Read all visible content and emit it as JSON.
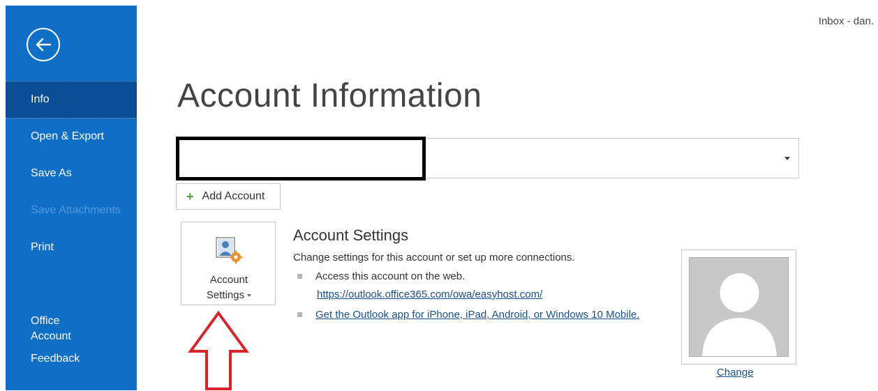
{
  "window": {
    "title": "Inbox - dan."
  },
  "sidebar": {
    "items": [
      {
        "label": "Info"
      },
      {
        "label": "Open & Export"
      },
      {
        "label": "Save As"
      },
      {
        "label": "Save Attachments"
      },
      {
        "label": "Print"
      },
      {
        "label": "Office\nAccount"
      },
      {
        "label": "Feedback"
      }
    ]
  },
  "main": {
    "title": "Account Information",
    "add_account_label": "Add Account",
    "account_settings": {
      "tile_line1": "Account",
      "tile_line2": "Settings",
      "heading": "Account Settings",
      "description": "Change settings for this account or set up more connections.",
      "web_access_text": "Access this account on the web.",
      "web_link": "https://outlook.office365.com/owa/easyhost.com/",
      "app_link": "Get the Outlook app for iPhone, iPad, Android, or Windows 10 Mobile."
    },
    "photo": {
      "change_label": "Change"
    }
  },
  "colors": {
    "sidebar_bg": "#0f6fc6",
    "sidebar_selected": "#0a4f96",
    "link": "#1a4f8c",
    "annotation_arrow": "#d9232a"
  }
}
